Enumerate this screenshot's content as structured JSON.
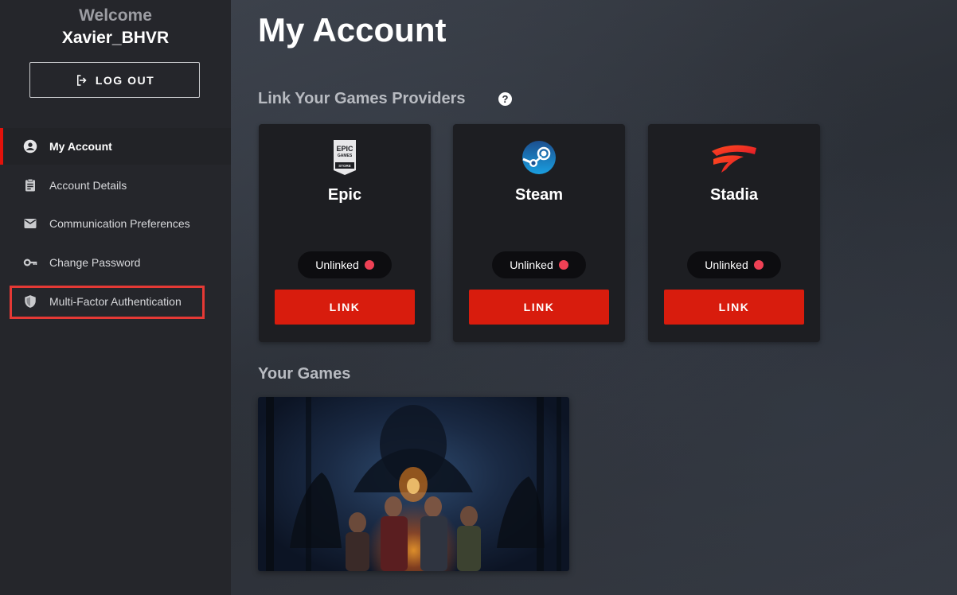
{
  "sidebar": {
    "welcome": "Welcome",
    "username": "Xavier_BHVR",
    "logout_label": "LOG OUT",
    "items": [
      {
        "label": "My Account",
        "icon": "user-circle-icon",
        "active": true
      },
      {
        "label": "Account Details",
        "icon": "clipboard-icon"
      },
      {
        "label": "Communication Preferences",
        "icon": "envelope-icon"
      },
      {
        "label": "Change Password",
        "icon": "key-icon"
      },
      {
        "label": "Multi-Factor Authentication",
        "icon": "shield-icon"
      }
    ]
  },
  "main": {
    "title": "My Account",
    "providers_heading": "Link Your Games Providers",
    "providers": [
      {
        "name": "Epic",
        "status": "Unlinked",
        "button": "LINK",
        "logo_text": [
          "EPIC",
          "GAMES",
          "STORE"
        ]
      },
      {
        "name": "Steam",
        "status": "Unlinked",
        "button": "LINK"
      },
      {
        "name": "Stadia",
        "status": "Unlinked",
        "button": "LINK"
      }
    ],
    "games_heading": "Your Games"
  },
  "colors": {
    "accent_red": "#d81c0d",
    "status_dot": "#ef4155",
    "sidebar_bg": "#25262b",
    "card_bg": "#1d1e22"
  }
}
